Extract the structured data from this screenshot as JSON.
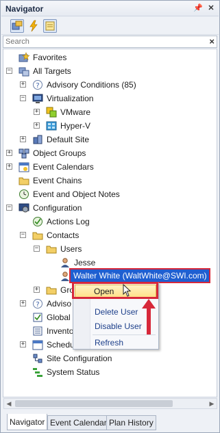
{
  "panel": {
    "title": "Navigator",
    "pin_icon": "pin-icon",
    "close_icon": "close-icon"
  },
  "toolbar": {
    "buttons": [
      "targets-view-icon",
      "lightning-icon",
      "notes-icon"
    ]
  },
  "search": {
    "placeholder": "Search",
    "clear_label": "×"
  },
  "tree": {
    "favorites": "Favorites",
    "all_targets": "All Targets",
    "advisory_conditions": "Advisory Conditions (85)",
    "virtualization": "Virtualization",
    "vmware": "VMware",
    "hyperv": "Hyper-V",
    "default_site": "Default Site",
    "object_groups": "Object Groups",
    "event_calendars": "Event Calendars",
    "event_chains": "Event Chains",
    "event_object_notes": "Event and Object Notes",
    "configuration": "Configuration",
    "actions_log": "Actions Log",
    "contacts": "Contacts",
    "users": "Users",
    "jesse": "Jesse",
    "walter": "Walter White (WaltWhite@SWI.com)",
    "groups_partial": "Gro",
    "adviso_partial": "Adviso",
    "global_partial": "Global",
    "invento_partial": "Invento",
    "schedu_partial": "Schedu",
    "site_configuration": "Site Configuration",
    "system_status": "System Status"
  },
  "context_menu": {
    "open": "Open",
    "delete_user": "Delete User",
    "disable_user": "Disable User",
    "refresh": "Refresh"
  },
  "tabs": [
    "Navigator",
    "Event Calendar",
    "Plan History"
  ],
  "colors": {
    "selection": "#1f5fd1",
    "annotation": "#d7283a",
    "hover": "#ffe18a"
  }
}
